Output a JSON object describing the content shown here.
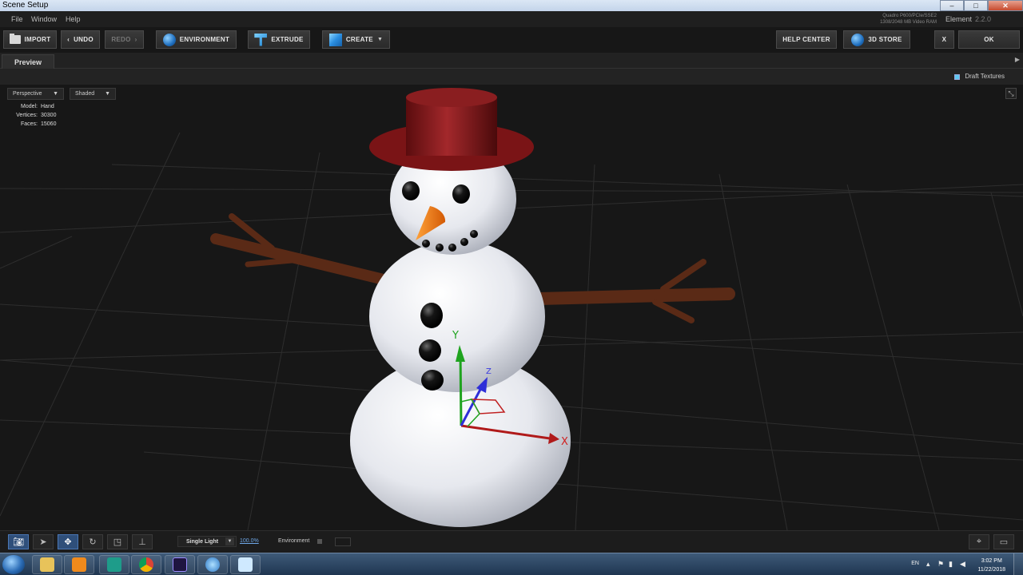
{
  "window": {
    "title": "Scene Setup",
    "controls": {
      "minimize": "–",
      "maximize": "□",
      "close": "✕"
    }
  },
  "menu": {
    "items": [
      "File",
      "Window",
      "Help"
    ]
  },
  "gpu": {
    "line1": "Quadro P600/PCIe/SSE2",
    "line2": "1308/2048 MB Video RAM"
  },
  "product": {
    "name": "Element",
    "version": "2.2.0"
  },
  "toolbar": {
    "import": "IMPORT",
    "undo": "UNDO",
    "redo": "REDO",
    "environment": "ENVIRONMENT",
    "extrude": "EXTRUDE",
    "create": "CREATE",
    "help_center": "HELP CENTER",
    "store": "3D STORE",
    "close": "X",
    "ok": "OK"
  },
  "tabs": {
    "preview": "Preview"
  },
  "options": {
    "draft_textures": "Draft Textures",
    "draft_textures_checked": true
  },
  "viewport": {
    "camera": "Perspective",
    "shading": "Shaded",
    "stats": [
      {
        "label": "Model:",
        "value": "Hand"
      },
      {
        "label": "Vertices:",
        "value": "30300"
      },
      {
        "label": "Faces:",
        "value": "15060"
      }
    ],
    "gizmo": {
      "x_label": "X",
      "y_label": "Y",
      "z_label": "Z"
    }
  },
  "bottom": {
    "light": "Single Light",
    "light_pct": "100.0%",
    "environment": "Environment"
  },
  "taskbar": {
    "lang": "EN",
    "time": "3:02 PM",
    "date": "11/22/2018",
    "apps": [
      "explorer",
      "media-player",
      "3d-app",
      "chrome",
      "after-effects",
      "element-app",
      "notes"
    ]
  },
  "colors": {
    "accent": "#4a77b5",
    "hat": "#7a1416",
    "carrot": "#f07a12",
    "stick": "#5a2a16"
  }
}
